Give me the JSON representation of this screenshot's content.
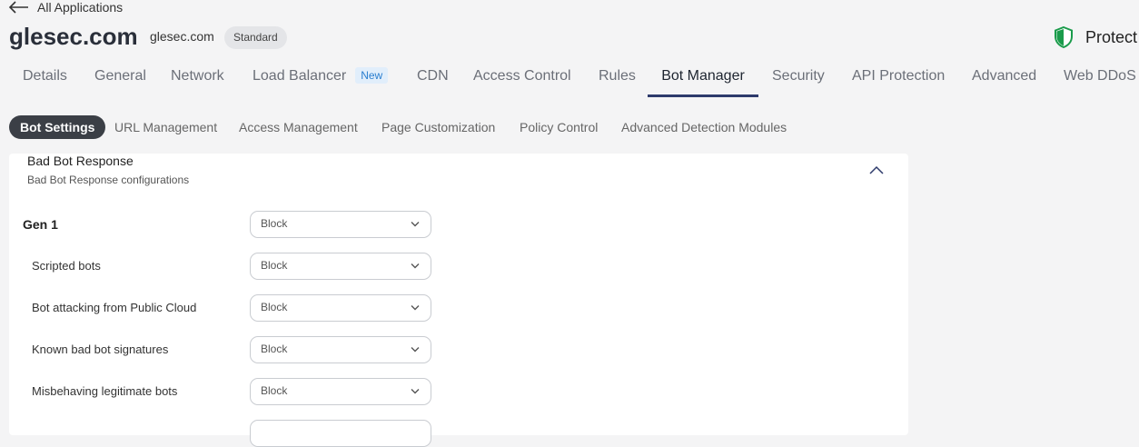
{
  "nav": {
    "back_label": "All Applications"
  },
  "app": {
    "title": "glesec.com",
    "domain": "glesec.com",
    "plan_badge": "Standard",
    "status_label": "Protect"
  },
  "tabs": [
    {
      "label": "Details"
    },
    {
      "label": "General"
    },
    {
      "label": "Network"
    },
    {
      "label": "Load Balancer",
      "badge": "New"
    },
    {
      "label": "CDN"
    },
    {
      "label": "Access Control"
    },
    {
      "label": "Rules"
    },
    {
      "label": "Bot Manager",
      "active": true
    },
    {
      "label": "Security"
    },
    {
      "label": "API Protection"
    },
    {
      "label": "Advanced"
    },
    {
      "label": "Web DDoS P"
    }
  ],
  "subtabs": [
    {
      "label": "Bot Settings",
      "active": true
    },
    {
      "label": "URL Management"
    },
    {
      "label": "Access Management"
    },
    {
      "label": "Page Customization"
    },
    {
      "label": "Policy Control"
    },
    {
      "label": "Advanced Detection Modules"
    }
  ],
  "section": {
    "title": "Bad Bot Response",
    "subtitle": "Bad Bot Response configurations",
    "rows": [
      {
        "label": "Gen 1",
        "value": "Block",
        "group": true
      },
      {
        "label": "Scripted bots",
        "value": "Block"
      },
      {
        "label": "Bot attacking from Public Cloud",
        "value": "Block"
      },
      {
        "label": "Known bad bot signatures",
        "value": "Block"
      },
      {
        "label": "Misbehaving legitimate bots",
        "value": "Block"
      }
    ]
  },
  "colors": {
    "active_tab_underline": "#2d3a6b",
    "shield_green": "#1a9b4b",
    "new_badge_text": "#2a7ecf"
  },
  "icons": [
    "arrow-left-icon",
    "shield-icon",
    "chevron-up-icon",
    "chevron-down-icon"
  ]
}
